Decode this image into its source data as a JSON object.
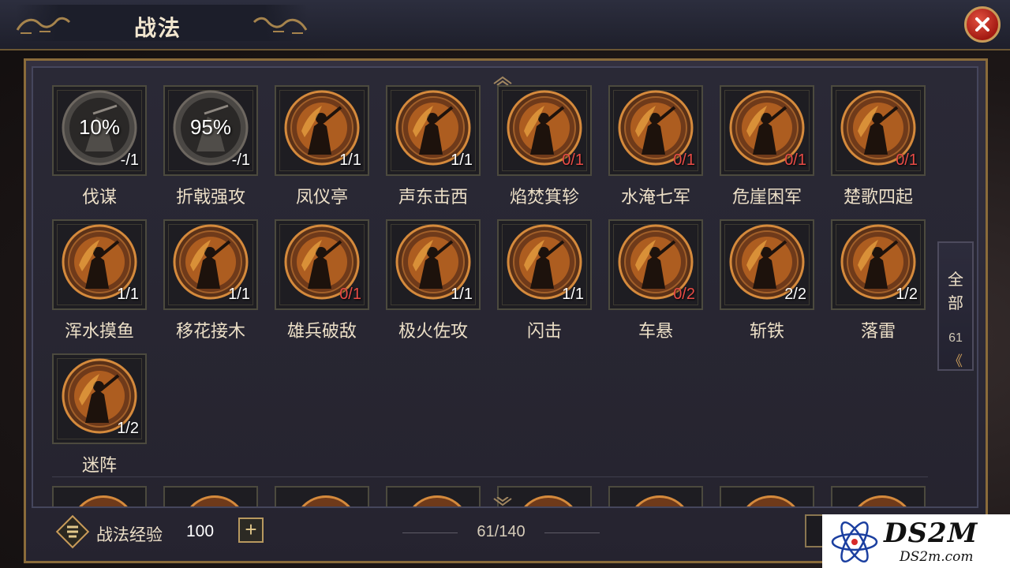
{
  "header": {
    "title": "战法"
  },
  "colors": {
    "accent_gold": "#c89b59",
    "count_red": "#e84b45",
    "count_white": "#ffffff"
  },
  "skills": [
    {
      "name": "伐谋",
      "percent": "10%",
      "count": "-/1",
      "red": false,
      "locked": true
    },
    {
      "name": "折戟强攻",
      "percent": "95%",
      "count": "-/1",
      "red": false,
      "locked": true
    },
    {
      "name": "凤仪亭",
      "count": "1/1",
      "red": false
    },
    {
      "name": "声东击西",
      "count": "1/1",
      "red": false
    },
    {
      "name": "焰焚箕轸",
      "count": "0/1",
      "red": true
    },
    {
      "name": "水淹七军",
      "count": "0/1",
      "red": true
    },
    {
      "name": "危崖困军",
      "count": "0/1",
      "red": true
    },
    {
      "name": "楚歌四起",
      "count": "0/1",
      "red": true
    },
    {
      "name": "浑水摸鱼",
      "count": "1/1",
      "red": false
    },
    {
      "name": "移花接木",
      "count": "1/1",
      "red": false
    },
    {
      "name": "雄兵破敌",
      "count": "0/1",
      "red": true
    },
    {
      "name": "极火佐攻",
      "count": "1/1",
      "red": false
    },
    {
      "name": "闪击",
      "count": "1/1",
      "red": false
    },
    {
      "name": "车悬",
      "count": "0/2",
      "red": true
    },
    {
      "name": "斩铁",
      "count": "2/2",
      "red": false
    },
    {
      "name": "落雷",
      "count": "1/2",
      "red": false
    },
    {
      "name": "迷阵",
      "count": "1/2",
      "red": false
    }
  ],
  "side_tab": {
    "line1": "全",
    "line2": "部",
    "count": "61",
    "arrow": "《"
  },
  "bottom": {
    "exp_label": "战法经验",
    "exp_value": "100",
    "plus": "+",
    "pager": "61/140"
  },
  "watermark": {
    "brand": "DS2M",
    "domain": "DS2m.com"
  }
}
